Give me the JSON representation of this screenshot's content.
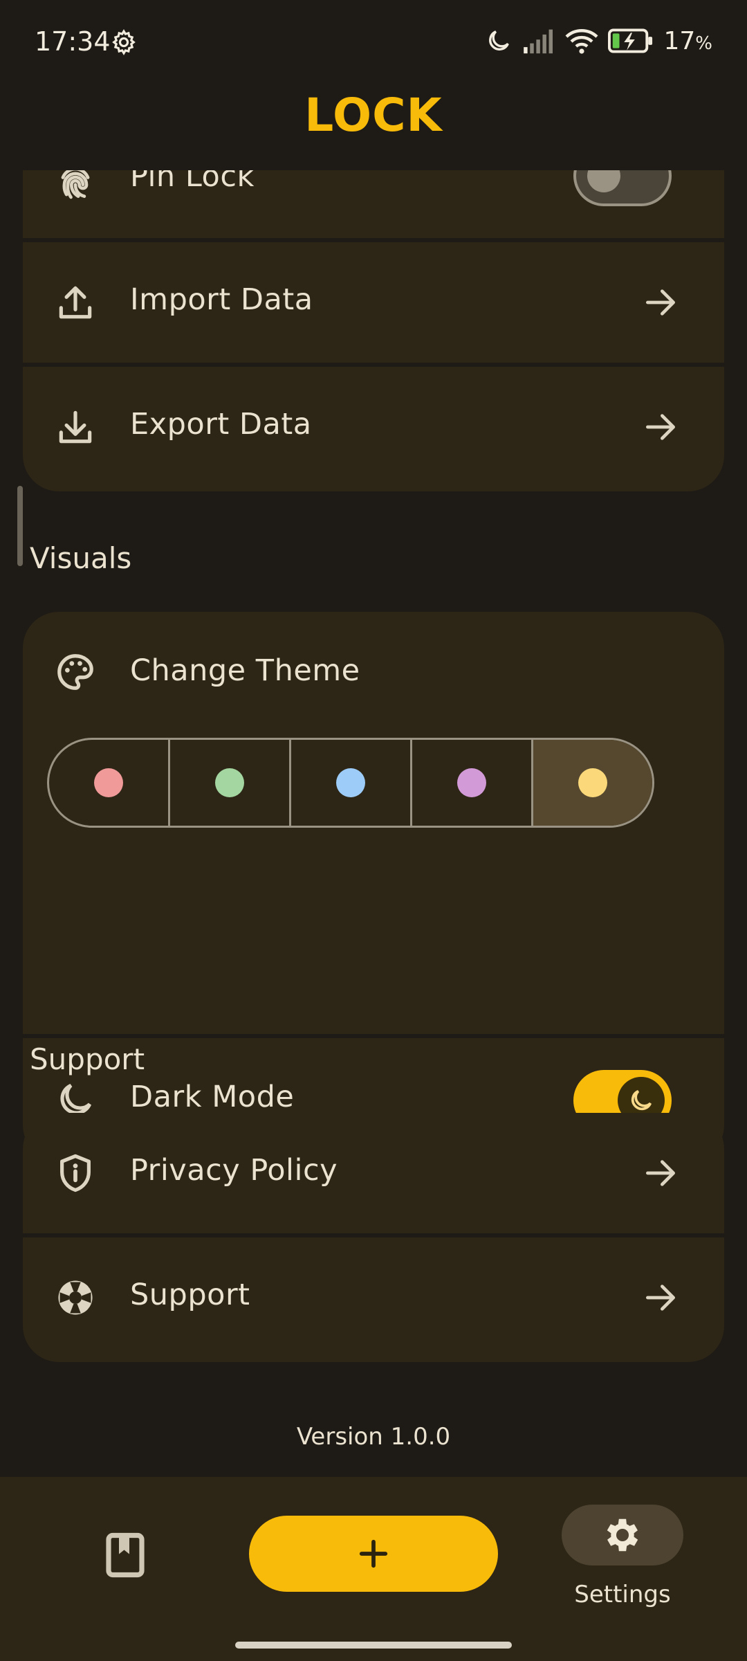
{
  "status_bar": {
    "time": "17:34",
    "battery": "17",
    "battery_unit": "%"
  },
  "header": {
    "title": "LOCK"
  },
  "security": {
    "pin_lock": {
      "label": "Pin Lock",
      "enabled": false
    },
    "import": {
      "label": "Import Data"
    },
    "export": {
      "label": "Export Data"
    }
  },
  "visuals": {
    "title": "Visuals",
    "change_theme": {
      "label": "Change Theme"
    },
    "themes": [
      {
        "name": "red",
        "color": "#f09a9a"
      },
      {
        "name": "green",
        "color": "#a3d6a0"
      },
      {
        "name": "blue",
        "color": "#9cccf7"
      },
      {
        "name": "purple",
        "color": "#d39ad8"
      },
      {
        "name": "yellow",
        "color": "#fbd97a",
        "selected": true
      }
    ],
    "dark_mode": {
      "label": "Dark Mode",
      "enabled": true
    }
  },
  "support": {
    "title": "Support",
    "privacy": {
      "label": "Privacy Policy"
    },
    "support_item": {
      "label": "Support"
    }
  },
  "version": "Version 1.0.0",
  "nav": {
    "settings_label": "Settings"
  },
  "colors": {
    "accent": "#f9bb0a",
    "background": "#1e1b16",
    "card": "#2d2616"
  }
}
